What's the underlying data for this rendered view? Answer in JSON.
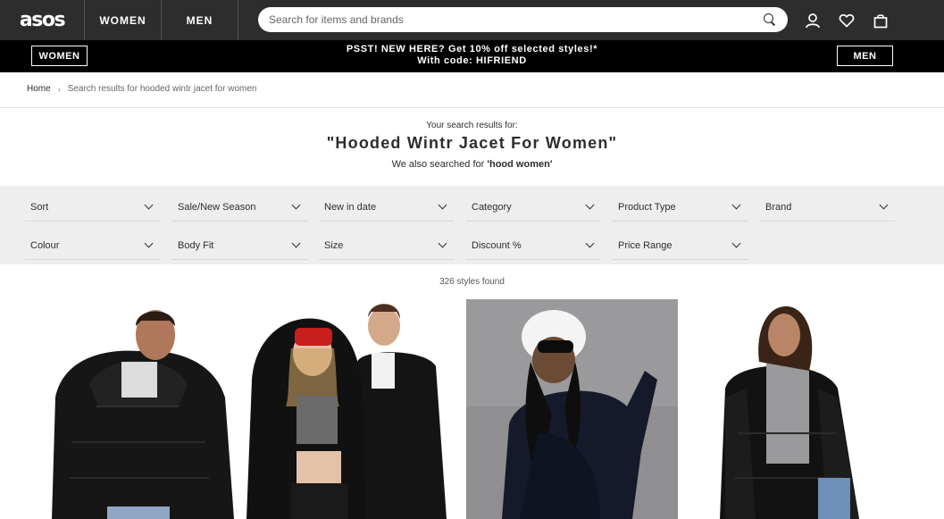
{
  "header": {
    "logo": "asos",
    "tabs": [
      "WOMEN",
      "MEN"
    ],
    "search_placeholder": "Search for items and brands",
    "icons": [
      "account-icon",
      "heart-icon",
      "bag-icon"
    ]
  },
  "promo": {
    "left_button": "WOMEN",
    "right_button": "MEN",
    "line1": "PSST! NEW HERE? Get 10% off selected styles!*",
    "line2": "With code: HIFRIEND"
  },
  "breadcrumb": {
    "home": "Home",
    "separator": "›",
    "current": "Search results for hooded wintr jacet for women"
  },
  "results": {
    "label": "Your search results for:",
    "query": "\"Hooded Wintr Jacet For Women\"",
    "also_prefix": "We also searched for",
    "also_term": "'hood women'",
    "count": "326 styles found"
  },
  "filters": {
    "row1": [
      "Sort",
      "Sale/New Season",
      "New in date",
      "Category",
      "Product Type",
      "Brand"
    ],
    "row2": [
      "Colour",
      "Body Fit",
      "Size",
      "Discount %",
      "Price Range"
    ]
  },
  "colors": {
    "header_bg": "#2d2d2d",
    "promo_bg": "#000000",
    "filter_bg": "#eeeeee",
    "text": "#2d2d2d"
  }
}
